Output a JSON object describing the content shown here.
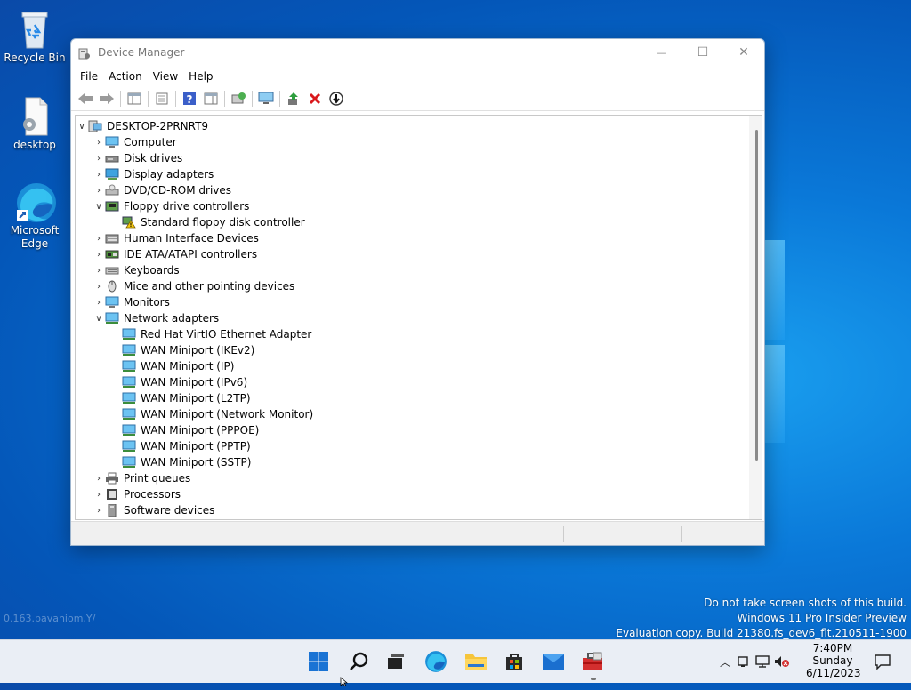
{
  "desktop": {
    "icons": [
      {
        "label": "Recycle Bin"
      },
      {
        "label": "desktop"
      },
      {
        "label": "Microsoft Edge"
      }
    ],
    "faint_text": "0.163.bavaniom,Y/"
  },
  "window": {
    "title": "Device Manager",
    "controls": {
      "minimize": "—",
      "maximize": "☐",
      "close": "✕"
    },
    "menu": [
      "File",
      "Action",
      "View",
      "Help"
    ],
    "tree": {
      "root": "DESKTOP-2PRNRT9",
      "items": [
        {
          "label": "Computer",
          "state": "collapsed",
          "icon": "computer-icon"
        },
        {
          "label": "Disk drives",
          "state": "collapsed",
          "icon": "disk-drive-icon"
        },
        {
          "label": "Display adapters",
          "state": "collapsed",
          "icon": "display-adapter-icon"
        },
        {
          "label": "DVD/CD-ROM drives",
          "state": "collapsed",
          "icon": "dvd-drive-icon"
        },
        {
          "label": "Floppy drive controllers",
          "state": "expanded",
          "icon": "floppy-controller-icon",
          "children": [
            {
              "label": "Standard floppy disk controller",
              "icon": "warning-device-icon"
            }
          ]
        },
        {
          "label": "Human Interface Devices",
          "state": "collapsed",
          "icon": "hid-icon"
        },
        {
          "label": "IDE ATA/ATAPI controllers",
          "state": "collapsed",
          "icon": "ide-controller-icon"
        },
        {
          "label": "Keyboards",
          "state": "collapsed",
          "icon": "keyboard-icon"
        },
        {
          "label": "Mice and other pointing devices",
          "state": "collapsed",
          "icon": "mouse-icon"
        },
        {
          "label": "Monitors",
          "state": "collapsed",
          "icon": "monitor-icon"
        },
        {
          "label": "Network adapters",
          "state": "expanded",
          "icon": "network-adapter-icon",
          "children": [
            {
              "label": "Red Hat VirtIO Ethernet Adapter",
              "icon": "network-adapter-icon"
            },
            {
              "label": "WAN Miniport (IKEv2)",
              "icon": "network-adapter-icon"
            },
            {
              "label": "WAN Miniport (IP)",
              "icon": "network-adapter-icon"
            },
            {
              "label": "WAN Miniport (IPv6)",
              "icon": "network-adapter-icon"
            },
            {
              "label": "WAN Miniport (L2TP)",
              "icon": "network-adapter-icon"
            },
            {
              "label": "WAN Miniport (Network Monitor)",
              "icon": "network-adapter-icon"
            },
            {
              "label": "WAN Miniport (PPPOE)",
              "icon": "network-adapter-icon"
            },
            {
              "label": "WAN Miniport (PPTP)",
              "icon": "network-adapter-icon"
            },
            {
              "label": "WAN Miniport (SSTP)",
              "icon": "network-adapter-icon"
            }
          ]
        },
        {
          "label": "Print queues",
          "state": "collapsed",
          "icon": "printer-icon"
        },
        {
          "label": "Processors",
          "state": "collapsed",
          "icon": "processor-icon"
        },
        {
          "label": "Software devices",
          "state": "collapsed",
          "icon": "software-device-icon"
        }
      ]
    }
  },
  "watermark": {
    "line1": "Do not take screen shots of this build.",
    "line2": "Windows 11 Pro Insider Preview",
    "line3": "Evaluation copy. Build 21380.fs_dev6_flt.210511-1900"
  },
  "taskbar": {
    "clock": {
      "time": "7:40PM",
      "day": "Sunday",
      "date": "6/11/2023"
    }
  },
  "colors": {
    "accent": "#0a78d8",
    "window_border": "#9db5cf",
    "taskbar": "#eaeef5"
  }
}
